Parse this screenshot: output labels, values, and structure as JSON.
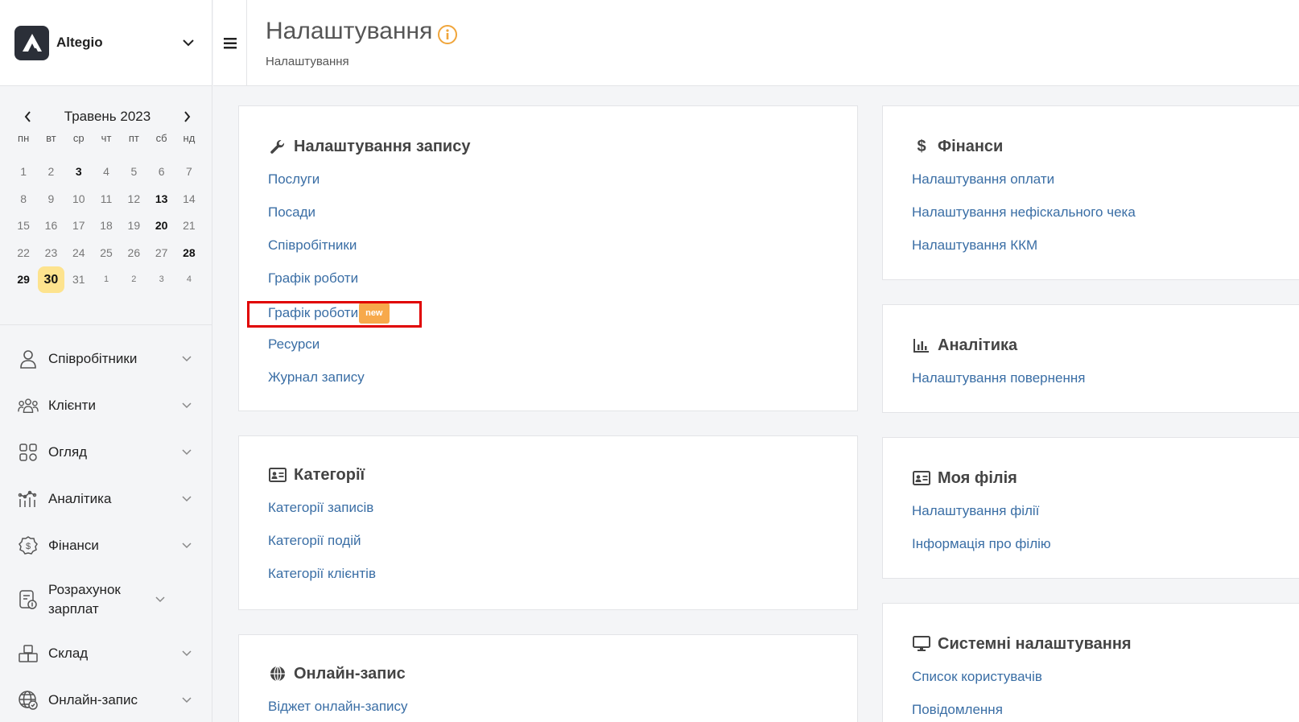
{
  "brand": {
    "name": "Altegio"
  },
  "calendar": {
    "month_label": "Травень 2023",
    "weekdays": [
      "пн",
      "вт",
      "ср",
      "чт",
      "пт",
      "сб",
      "нд"
    ],
    "weeks": [
      [
        "1",
        "2",
        "3",
        "4",
        "5",
        "6",
        "7"
      ],
      [
        "8",
        "9",
        "10",
        "11",
        "12",
        "13",
        "14"
      ],
      [
        "15",
        "16",
        "17",
        "18",
        "19",
        "20",
        "21"
      ],
      [
        "22",
        "23",
        "24",
        "25",
        "26",
        "27",
        "28"
      ],
      [
        "29",
        "30",
        "31",
        "1",
        "2",
        "3",
        "4"
      ]
    ],
    "today": "30"
  },
  "nav": {
    "items": [
      {
        "label": "Співробітники",
        "icon": "user-icon"
      },
      {
        "label": "Клієнти",
        "icon": "clients-icon"
      },
      {
        "label": "Огляд",
        "icon": "grid-icon"
      },
      {
        "label": "Аналітика",
        "icon": "analytics-icon"
      },
      {
        "label": "Фінанси",
        "icon": "dollar-icon"
      },
      {
        "label": "Розрахунок зарплат",
        "icon": "payroll-icon"
      },
      {
        "label": "Склад",
        "icon": "warehouse-icon"
      },
      {
        "label": "Онлайн-запис",
        "icon": "globe-icon"
      }
    ]
  },
  "header": {
    "title": "Налаштування",
    "breadcrumb": "Налаштування"
  },
  "cards": {
    "booking": {
      "title": "Налаштування запису",
      "icon": "wrench-icon",
      "links": [
        "Послуги",
        "Посади",
        "Співробітники",
        "Графік роботи",
        "Графік роботи",
        "Ресурси",
        "Журнал запису"
      ],
      "new_badge": "new"
    },
    "categories": {
      "title": "Категорії",
      "icon": "id-card-icon",
      "links": [
        "Категорії записів",
        "Категорії подій",
        "Категорії клієнтів"
      ]
    },
    "online": {
      "title": "Онлайн-запис",
      "icon": "globe-icon",
      "links": [
        "Віджет онлайн-запису"
      ]
    },
    "finance": {
      "title": "Фінанси",
      "icon": "dollar-icon",
      "links": [
        "Налаштування оплати",
        "Налаштування нефіскального чека",
        "Налаштування ККМ"
      ]
    },
    "analytics": {
      "title": "Аналітика",
      "icon": "bar-chart-icon",
      "links": [
        "Налаштування повернення"
      ]
    },
    "branch": {
      "title": "Моя філія",
      "icon": "id-card-icon",
      "links": [
        "Налаштування філії",
        "Інформація про філію"
      ]
    },
    "system": {
      "title": "Системні налаштування",
      "icon": "monitor-icon",
      "links": [
        "Список користувачів",
        "Повідомлення"
      ]
    }
  },
  "colors": {
    "link": "#3a6ea5",
    "today_bg": "#fde38e",
    "badge": "#f7a94b",
    "highlight": "#e00000",
    "info_icon": "#f0a53a"
  }
}
